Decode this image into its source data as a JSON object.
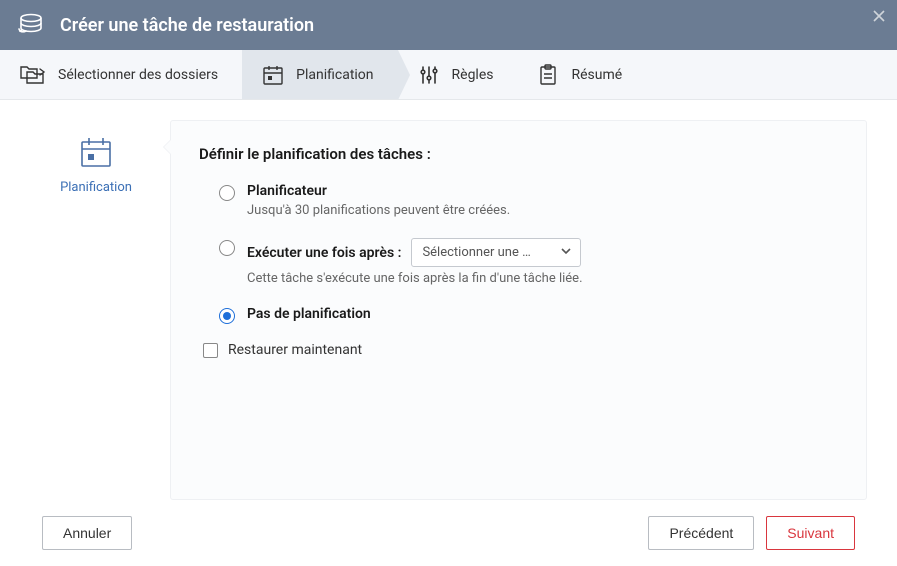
{
  "header": {
    "title": "Créer une tâche de restauration"
  },
  "wizard": {
    "steps": [
      {
        "label": "Sélectionner des dossiers"
      },
      {
        "label": "Planification"
      },
      {
        "label": "Règles"
      },
      {
        "label": "Résumé"
      }
    ]
  },
  "left": {
    "label": "Planification"
  },
  "panel": {
    "title": "Définir le planification des tâches :",
    "options": {
      "scheduler": {
        "label": "Planificateur",
        "desc": "Jusqu'à 30 planifications peuvent être créées."
      },
      "run_once": {
        "label": "Exécuter une fois après :",
        "desc": "Cette tâche s'exécute une fois après la fin d'une tâche liée.",
        "select_placeholder": "Sélectionner une …"
      },
      "no_schedule": {
        "label": "Pas de planification"
      }
    },
    "restore_now": "Restaurer maintenant"
  },
  "footer": {
    "cancel": "Annuler",
    "previous": "Précédent",
    "next": "Suivant"
  }
}
